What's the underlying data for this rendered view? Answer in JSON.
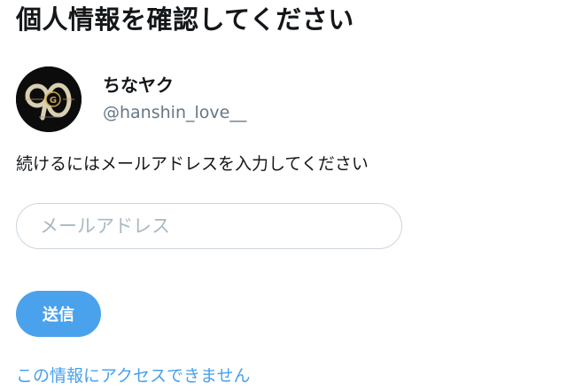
{
  "header": {
    "title": "個人情報を確認してください"
  },
  "account": {
    "display_name": "ちなヤク",
    "handle": "@hanshin_love__",
    "avatar_icon": "team-logo-avatar-icon"
  },
  "form": {
    "instruction": "続けるにはメールアドレスを入力してください",
    "email_value": "",
    "email_placeholder": "メールアドレス",
    "submit_label": "送信"
  },
  "footer": {
    "help_link": "この情報にアクセスできません"
  },
  "colors": {
    "accent": "#4aa1ec",
    "muted_text": "#657786",
    "input_border": "#ccd6dd",
    "placeholder": "#aab8c2",
    "text": "#14171a"
  }
}
